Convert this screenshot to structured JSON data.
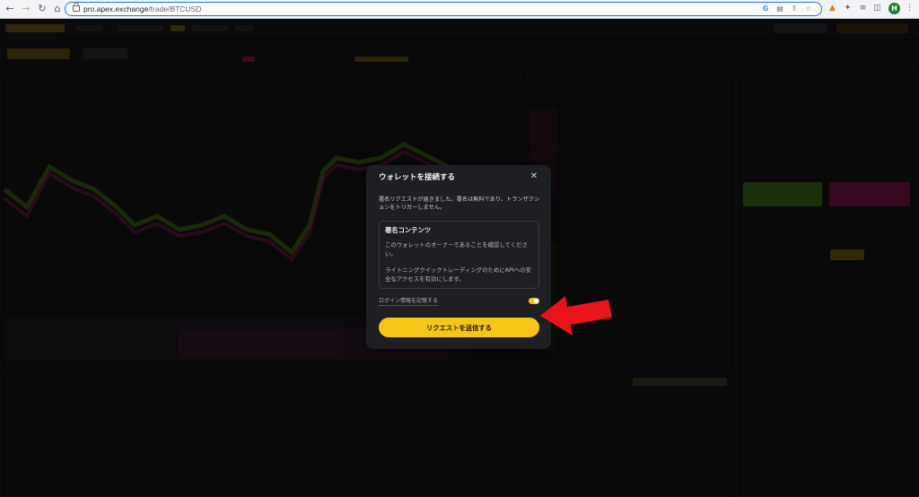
{
  "browser": {
    "url_host": "pro.apex.exchange",
    "url_path": "/trade/BTCUSD",
    "profile_initial": "H"
  },
  "modal": {
    "title": "ウォレットを接続する",
    "description": "署名リクエストが届きました。署名は無料であり、トランザクションをトリガーしません。",
    "content_title": "署名コンテンツ",
    "content_line1": "このウォレットのオーナーであることを確認してください。",
    "content_line2": "ライトニングクイックトレーディングのためにAPIへの安全なアクセスを有効にします。",
    "remember_label": "ログイン情報を記憶する",
    "remember_checked": true,
    "submit_label": "リクエストを送信する",
    "accent_color": "#f5c518"
  },
  "annotation": {
    "arrow_color": "#e8141a"
  }
}
